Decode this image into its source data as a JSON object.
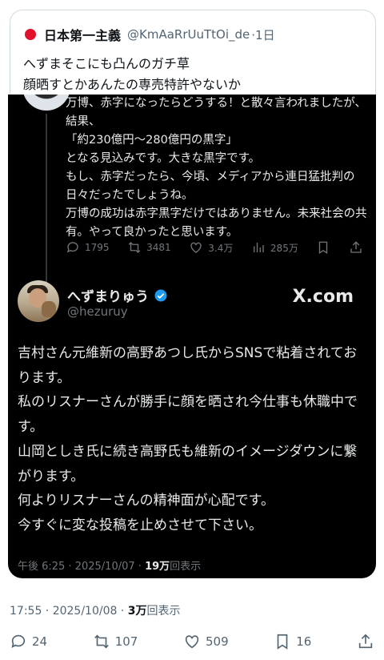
{
  "quote": {
    "name": "日本第一主義",
    "handle": "@KmAaRrUuTtOi_de",
    "time": "·1日",
    "line1": "へずまそこにも凸んのガチ草",
    "line2": "顔晒すとかあんたの専売特許やないか"
  },
  "previous_post": {
    "text": "万博、赤字になったらどうする！と散々言われましたが、結果、\n「約230億円〜280億円の黒字」\nとなる見込みです。大きな黒字です。\nもし、赤字だったら、今頃、メディアから連日猛批判の日々だったでしょうね。\n万博の成功は赤字黒字だけではありません。未来社会の共有。やって良かったと思います。",
    "replies": "1795",
    "reposts": "3481",
    "likes": "3.4万",
    "views": "285万"
  },
  "main_post": {
    "name": "へずまりゅう",
    "handle": "@hezuruy",
    "watermark": "X.com",
    "text": "吉村さん元維新の高野あつし氏からSNSで粘着されております。\n私のリスナーさんが勝手に顔を晒され今仕事も休職中です。\n山岡としき氏に続き高野氏も維新のイメージダウンに繋がります。\n何よりリスナーさんの精神面が心配です。\n今すぐに変な投稿を止めさせて下さい。",
    "timestamp": "午後 6:25 · 2025/10/07 · ",
    "views_count": "19万",
    "views_label": "回表示"
  },
  "outer": {
    "timestamp": "17:55 · 2025/10/08 · ",
    "views_count": "3万",
    "views_label": "回表示",
    "replies": "24",
    "reposts": "107",
    "likes": "509",
    "bookmarks": "16"
  },
  "colors": {
    "accent_blue": "#1d9bf0",
    "flag_red": "#e0112b",
    "dark_bg": "#000000"
  }
}
